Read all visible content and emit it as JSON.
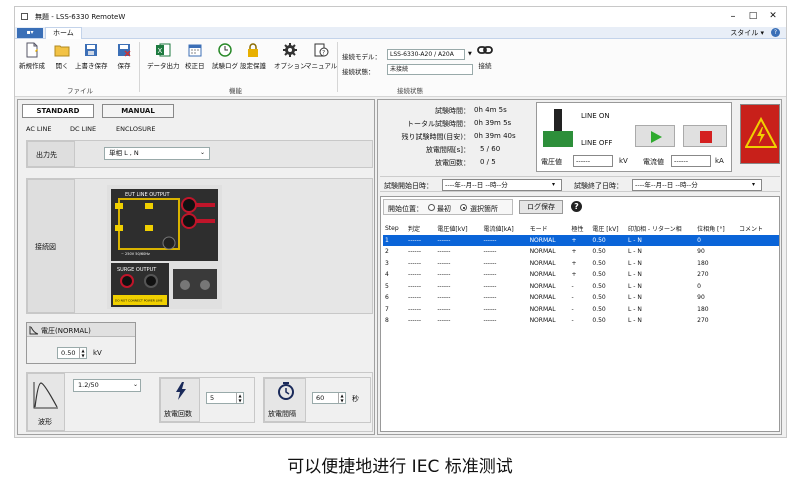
{
  "window": {
    "title": "無題 - LSS-6330 RemoteW",
    "minimize": "–",
    "maximize": "□",
    "close": "✕"
  },
  "menubar": {
    "file_label": "▪▾",
    "home_tab": "ホーム",
    "style_label": "スタイル ▾",
    "help_label": "?"
  },
  "ribbon": {
    "file_group": "ファイル",
    "function_group": "機能",
    "connection_group": "接続状態",
    "buttons": {
      "new": "新規作成",
      "open": "開く",
      "save_as": "上書き保存",
      "save": "保存",
      "data_out": "データ出力",
      "calib": "校正日",
      "log": "試験ログ",
      "protect": "設定保護",
      "option": "オプション",
      "manual": "マニュアル",
      "connect": "接続"
    },
    "model_label": "接続モデル：",
    "model_value": "LSS-6330-A20 / A20A",
    "state_label": "接続状態：",
    "state_value": "未接続"
  },
  "left": {
    "tab_standard": "STANDARD",
    "tab_manual": "MANUAL",
    "sub_ac": "AC LINE",
    "sub_dc": "DC LINE",
    "sub_enc": "ENCLOSURE",
    "output_label": "出力先",
    "output_value": "単相 L , N",
    "diagram_label": "接続図",
    "diagram": {
      "eut_title": "EUT LINE OUTPUT",
      "surge_title": "SURGE OUTPUT",
      "voltage_note": "~ 250V 50/60Hz",
      "warning": "DO NOT CONNECT POWER LINE"
    },
    "voltage_title": "電圧(NORMAL)",
    "voltage_value": "0.50",
    "voltage_unit": "kV",
    "wave_label": "波形",
    "wave_value": "1.2/50",
    "count_label": "放電回数",
    "count_value": "5",
    "interval_label": "放電間隔",
    "interval_value": "60",
    "interval_unit": "秒"
  },
  "right": {
    "test_time_label": "試験時間：",
    "test_time": "0h  4m  5s",
    "total_time_label": "トータル試験時間：",
    "total_time": "0h 39m  5s",
    "remain_label": "残り試験時間(目安)：",
    "remain": "0h 39m 40s",
    "disch_int_label": "放電間隔[s]：",
    "disch_int": "5 / 60",
    "disch_cnt_label": "放電回数：",
    "disch_cnt": "0 / 5",
    "line_on": "LINE ON",
    "line_off": "LINE OFF",
    "voltage_label": "電圧値",
    "voltage_reading": "------",
    "voltage_unit": "kV",
    "current_label": "電流値",
    "current_reading": "------",
    "current_unit": "kA",
    "start_label": "試験開始日時：",
    "start_value": "----年--月--日 --時--分",
    "end_label": "試験終了日時：",
    "end_value": "----年--月--日 --時--分",
    "start_pos_label": "開始位置：",
    "radio_first": "最初",
    "radio_selected": "選択箇所",
    "log_save": "ログ保存",
    "help_icon": "?",
    "table": {
      "headers": [
        "Step",
        "判定",
        "電圧値[kV]",
        "電流値[kA]",
        "モード",
        "極性",
        "電圧 [kV]",
        "印加相 - リターン相",
        "位相角 [°]",
        "コメント"
      ],
      "rows": [
        [
          "1",
          "------",
          "------",
          "------",
          "NORMAL",
          "+",
          "0.50",
          "L - N",
          "0",
          ""
        ],
        [
          "2",
          "------",
          "------",
          "------",
          "NORMAL",
          "+",
          "0.50",
          "L - N",
          "90",
          ""
        ],
        [
          "3",
          "------",
          "------",
          "------",
          "NORMAL",
          "+",
          "0.50",
          "L - N",
          "180",
          ""
        ],
        [
          "4",
          "------",
          "------",
          "------",
          "NORMAL",
          "+",
          "0.50",
          "L - N",
          "270",
          ""
        ],
        [
          "5",
          "------",
          "------",
          "------",
          "NORMAL",
          "-",
          "0.50",
          "L - N",
          "0",
          ""
        ],
        [
          "6",
          "------",
          "------",
          "------",
          "NORMAL",
          "-",
          "0.50",
          "L - N",
          "90",
          ""
        ],
        [
          "7",
          "------",
          "------",
          "------",
          "NORMAL",
          "-",
          "0.50",
          "L - N",
          "180",
          ""
        ],
        [
          "8",
          "------",
          "------",
          "------",
          "NORMAL",
          "-",
          "0.50",
          "L - N",
          "270",
          ""
        ]
      ]
    }
  },
  "caption": "可以便捷地进行 IEC 标准测试",
  "colors": {
    "accent": "#0a64d8",
    "play": "#2faa2f",
    "stop": "#d42020",
    "danger": "#c8201a"
  }
}
